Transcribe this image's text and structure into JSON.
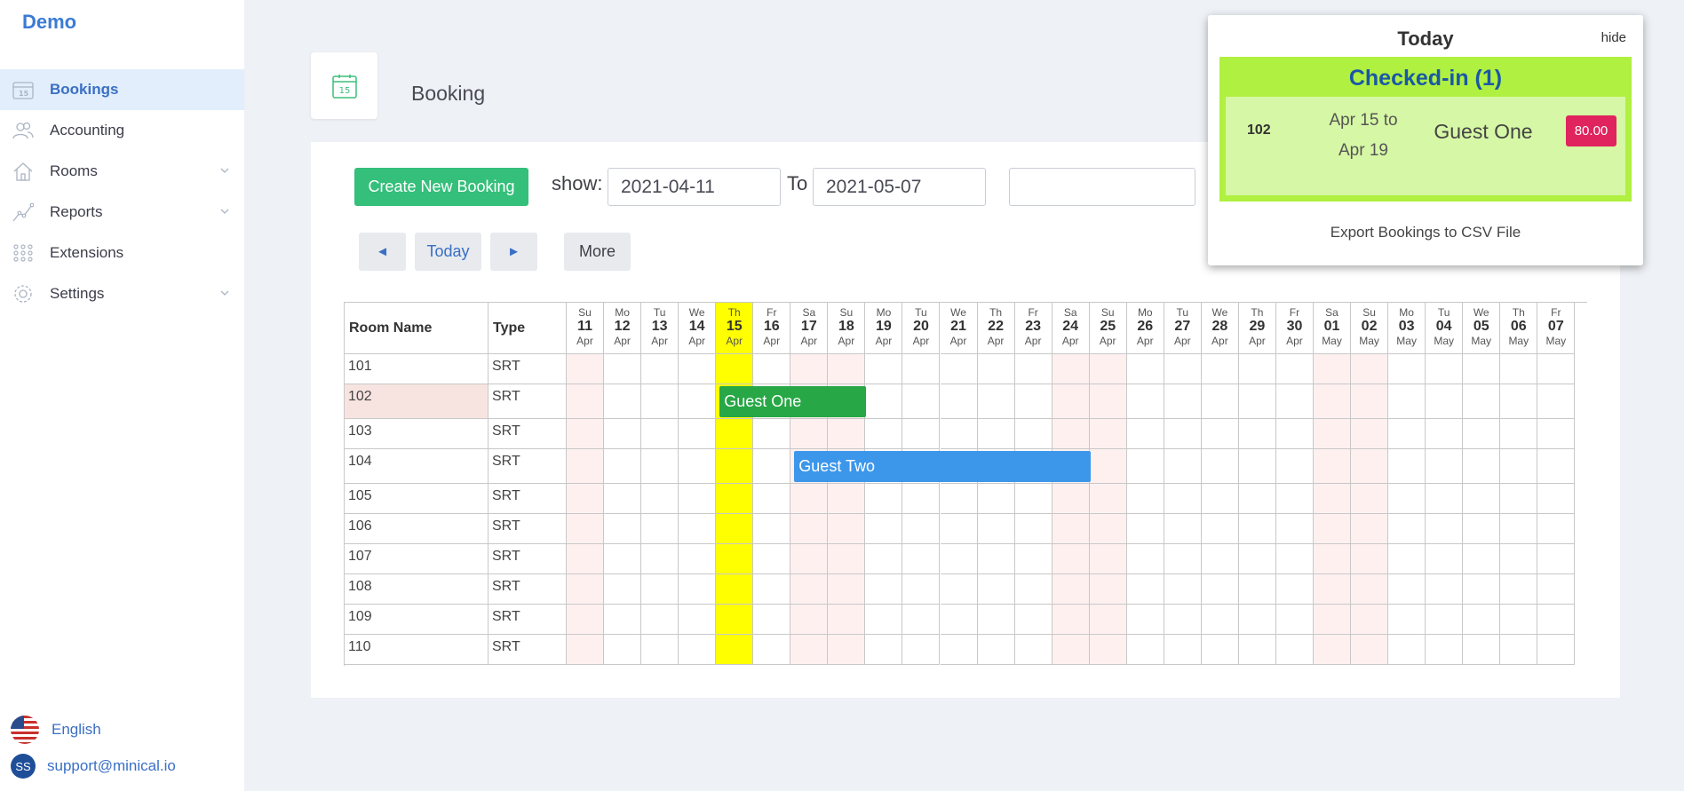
{
  "brand": "Demo",
  "sidebar": {
    "items": [
      {
        "label": "Bookings",
        "icon": "calendar-icon",
        "active": true
      },
      {
        "label": "Accounting",
        "icon": "users-icon"
      },
      {
        "label": "Rooms",
        "icon": "home-icon",
        "has_children": true
      },
      {
        "label": "Reports",
        "icon": "chart-line-icon",
        "has_children": true
      },
      {
        "label": "Extensions",
        "icon": "grid-dots-icon"
      },
      {
        "label": "Settings",
        "icon": "gear-icon",
        "has_children": true
      }
    ],
    "language": "English",
    "user_initials": "SS",
    "user_email": "support@minical.io"
  },
  "header": {
    "page_icon_day": "15",
    "title": "Booking"
  },
  "toolbar": {
    "create_label": "Create New Booking",
    "show_label": "show:",
    "from_date": "2021-04-11",
    "to_label": "To",
    "to_date": "2021-05-07",
    "search_value": "",
    "prev_label": "◄",
    "today_label": "Today",
    "next_label": "►",
    "more_label": "More"
  },
  "grid": {
    "room_header": "Room Name",
    "type_header": "Type",
    "days": [
      {
        "dow": "Su",
        "date": "11",
        "mon": "Apr",
        "weekend": true
      },
      {
        "dow": "Mo",
        "date": "12",
        "mon": "Apr"
      },
      {
        "dow": "Tu",
        "date": "13",
        "mon": "Apr"
      },
      {
        "dow": "We",
        "date": "14",
        "mon": "Apr"
      },
      {
        "dow": "Th",
        "date": "15",
        "mon": "Apr",
        "today": true
      },
      {
        "dow": "Fr",
        "date": "16",
        "mon": "Apr"
      },
      {
        "dow": "Sa",
        "date": "17",
        "mon": "Apr",
        "weekend": true
      },
      {
        "dow": "Su",
        "date": "18",
        "mon": "Apr",
        "weekend": true
      },
      {
        "dow": "Mo",
        "date": "19",
        "mon": "Apr"
      },
      {
        "dow": "Tu",
        "date": "20",
        "mon": "Apr"
      },
      {
        "dow": "We",
        "date": "21",
        "mon": "Apr"
      },
      {
        "dow": "Th",
        "date": "22",
        "mon": "Apr"
      },
      {
        "dow": "Fr",
        "date": "23",
        "mon": "Apr"
      },
      {
        "dow": "Sa",
        "date": "24",
        "mon": "Apr",
        "weekend": true
      },
      {
        "dow": "Su",
        "date": "25",
        "mon": "Apr",
        "weekend": true
      },
      {
        "dow": "Mo",
        "date": "26",
        "mon": "Apr"
      },
      {
        "dow": "Tu",
        "date": "27",
        "mon": "Apr"
      },
      {
        "dow": "We",
        "date": "28",
        "mon": "Apr"
      },
      {
        "dow": "Th",
        "date": "29",
        "mon": "Apr"
      },
      {
        "dow": "Fr",
        "date": "30",
        "mon": "Apr"
      },
      {
        "dow": "Sa",
        "date": "01",
        "mon": "May",
        "weekend": true
      },
      {
        "dow": "Su",
        "date": "02",
        "mon": "May",
        "weekend": true
      },
      {
        "dow": "Mo",
        "date": "03",
        "mon": "May"
      },
      {
        "dow": "Tu",
        "date": "04",
        "mon": "May"
      },
      {
        "dow": "We",
        "date": "05",
        "mon": "May"
      },
      {
        "dow": "Th",
        "date": "06",
        "mon": "May"
      },
      {
        "dow": "Fr",
        "date": "07",
        "mon": "May"
      }
    ],
    "rooms": [
      {
        "name": "101",
        "type": "SRT"
      },
      {
        "name": "102",
        "type": "SRT",
        "highlighted": true
      },
      {
        "name": "103",
        "type": "SRT"
      },
      {
        "name": "104",
        "type": "SRT"
      },
      {
        "name": "105",
        "type": "SRT"
      },
      {
        "name": "106",
        "type": "SRT"
      },
      {
        "name": "107",
        "type": "SRT"
      },
      {
        "name": "108",
        "type": "SRT"
      },
      {
        "name": "109",
        "type": "SRT"
      },
      {
        "name": "110",
        "type": "SRT"
      }
    ],
    "bookings": [
      {
        "guest": "Guest One",
        "room": "102",
        "start_day": "15",
        "end_day": "19",
        "color": "#27a745"
      },
      {
        "guest": "Guest Two",
        "room": "104",
        "start_day": "17",
        "end_day": "25",
        "color": "#3c97eb"
      }
    ],
    "colors": {
      "today": "#ffff00",
      "weekend": "#fff0f0",
      "highlight_room": "#f7e4e0"
    }
  },
  "today_panel": {
    "title": "Today",
    "hide_label": "hide",
    "checked_in_label": "Checked-in (1)",
    "entry": {
      "room": "102",
      "dates": "Apr 15 to Apr 19",
      "guest": "Guest One",
      "amount": "80.00"
    },
    "export_label": "Export Bookings to CSV File"
  }
}
